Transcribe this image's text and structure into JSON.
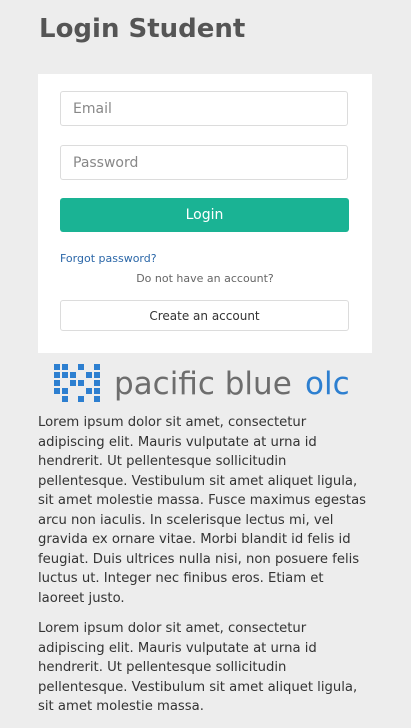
{
  "page": {
    "title": "Login Student"
  },
  "form": {
    "email_placeholder": "Email",
    "password_placeholder": "Password",
    "login_label": "Login",
    "forgot_password": "Forgot password?",
    "no_account_text": "Do not have an account?",
    "create_account_label": "Create an account"
  },
  "logo": {
    "brand_text": "pacific blue",
    "brand_suffix": "olc",
    "colors": {
      "mark": "#2d7fd0",
      "text": "#6d6d6d",
      "suffix": "#2d7fd0"
    }
  },
  "content": {
    "paragraphs": [
      "Lorem ipsum dolor sit amet, consectetur adipiscing elit. Mauris vulputate at urna id hendrerit. Ut pellentesque sollicitudin pellentesque. Vestibulum sit amet aliquet ligula, sit amet molestie massa. Fusce maximus egestas arcu non iaculis. In scelerisque lectus mi, vel gravida ex ornare vitae. Morbi blandit id felis id feugiat. Duis ultrices nulla nisi, non posuere felis luctus ut. Integer nec finibus eros. Etiam et laoreet justo.",
      "Lorem ipsum dolor sit amet, consectetur adipiscing elit. Mauris vulputate at urna id hendrerit. Ut pellentesque sollicitudin pellentesque. Vestibulum sit amet aliquet ligula, sit amet molestie massa."
    ]
  },
  "colors": {
    "background": "#ededed",
    "primary_button": "#1ab394",
    "link": "#2b67a8"
  }
}
